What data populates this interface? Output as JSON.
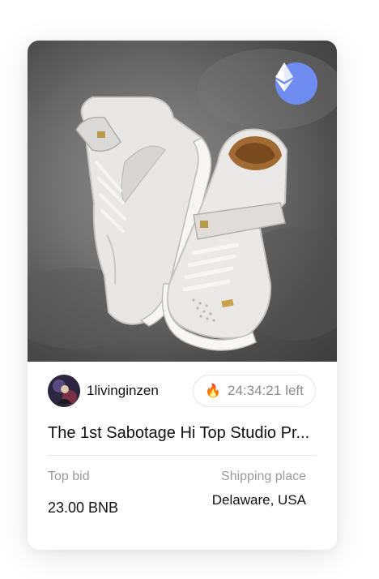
{
  "card": {
    "image_alt": "white high-top sneakers",
    "badge_icon": "ethereum-icon",
    "creator": {
      "name": "1livinginzen",
      "avatar_icon": "avatar"
    },
    "timer": {
      "icon": "fire-icon",
      "time": "24:34:21",
      "suffix": "left"
    },
    "title": "The 1st Sabotage Hi Top Studio Pr...",
    "top_bid": {
      "label": "Top bid",
      "value": "23.00 BNB"
    },
    "shipping": {
      "label": "Shipping place",
      "value": "Delaware, USA"
    }
  },
  "colors": {
    "eth_badge": "#6f8df1",
    "text_primary": "#111111",
    "text_muted": "#9a9a9a"
  }
}
